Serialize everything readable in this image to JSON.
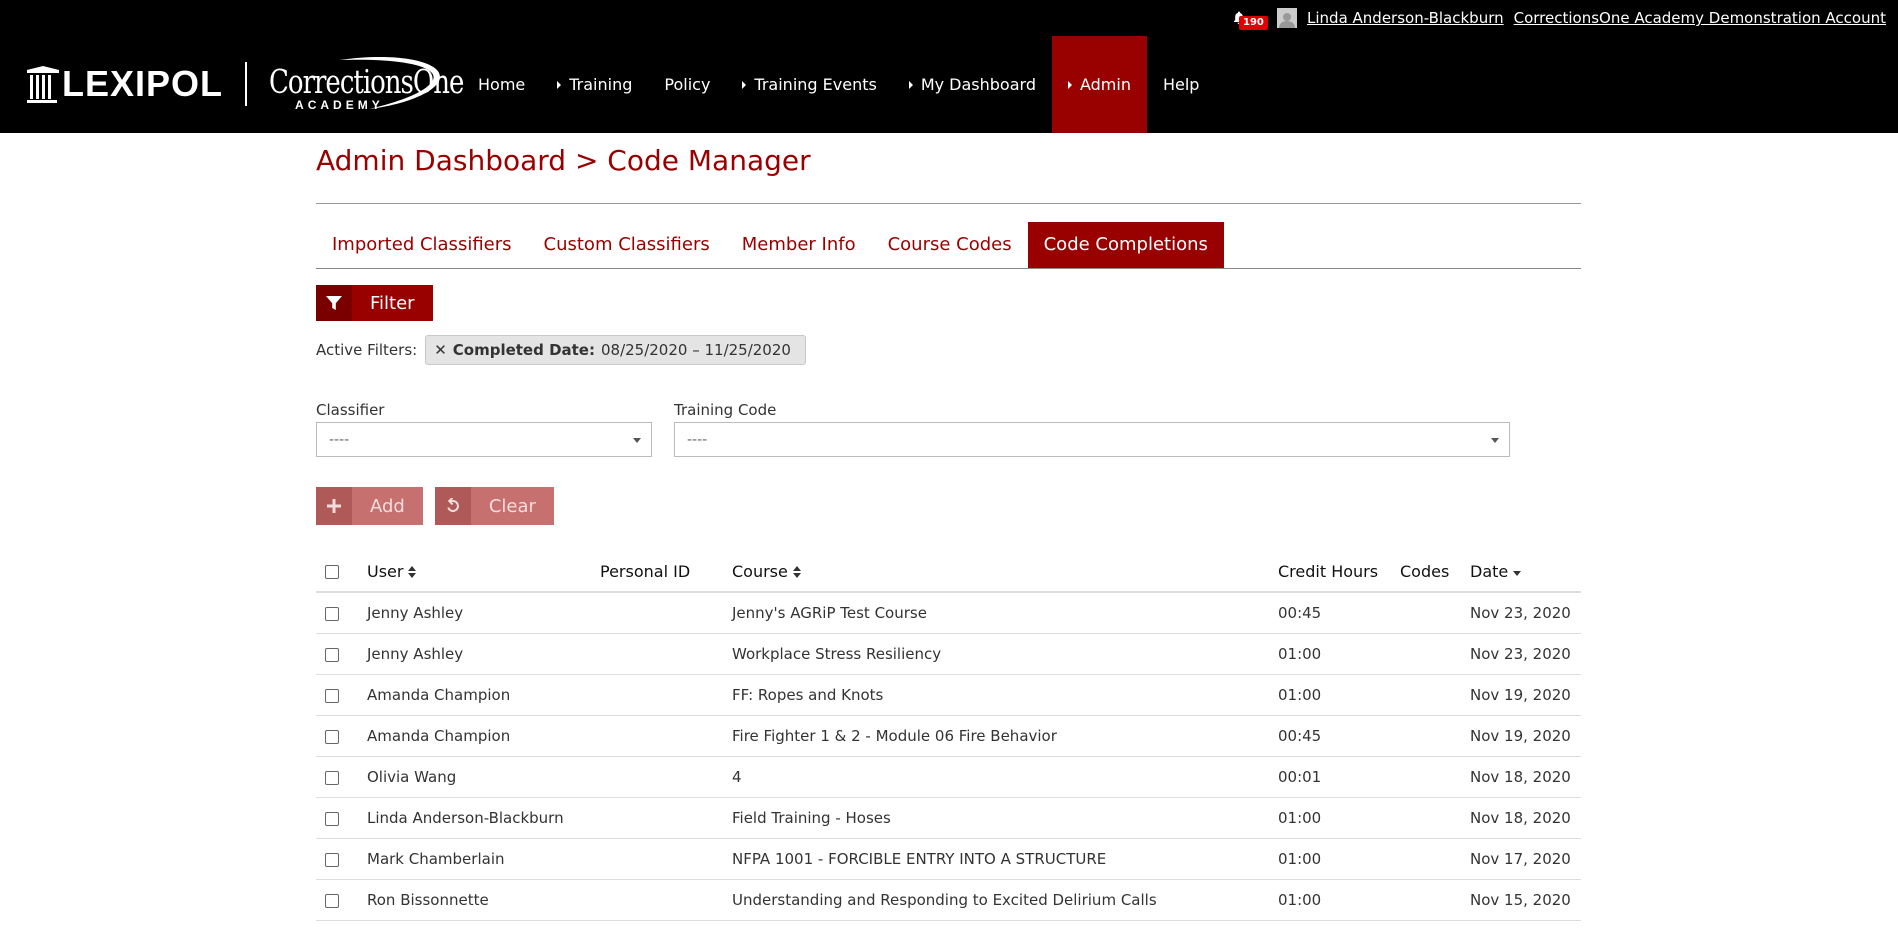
{
  "topbar": {
    "notification_count": "190",
    "user_name": "Linda Anderson-Blackburn",
    "account_name": "CorrectionsOne Academy Demonstration Account"
  },
  "brand": {
    "lexipol": "LEXIPOL",
    "academy_name": "CorrectionsOne",
    "academy_sub": "ACADEMY"
  },
  "nav": {
    "items": [
      {
        "label": "Home"
      },
      {
        "label": "Training"
      },
      {
        "label": "Policy"
      },
      {
        "label": "Training Events"
      },
      {
        "label": "My Dashboard"
      },
      {
        "label": "Admin"
      },
      {
        "label": "Help"
      }
    ]
  },
  "page": {
    "title": "Admin Dashboard > Code Manager"
  },
  "tabs": [
    {
      "label": "Imported Classifiers"
    },
    {
      "label": "Custom Classifiers"
    },
    {
      "label": "Member Info"
    },
    {
      "label": "Course Codes"
    },
    {
      "label": "Code Completions"
    }
  ],
  "filter": {
    "button_label": "Filter",
    "active_label": "Active Filters:",
    "chip_key": "Completed Date:",
    "chip_value": "08/25/2020 – 11/25/2020"
  },
  "selects": {
    "classifier_label": "Classifier",
    "classifier_value": "----",
    "training_code_label": "Training Code",
    "training_code_value": "----"
  },
  "actions": {
    "add_label": "Add",
    "clear_label": "Clear"
  },
  "table": {
    "headers": {
      "user": "User",
      "personal_id": "Personal ID",
      "course": "Course",
      "credit_hours": "Credit Hours",
      "codes": "Codes",
      "date": "Date"
    },
    "rows": [
      {
        "user": "Jenny Ashley",
        "personal_id": "",
        "course": "Jenny's AGRiP Test Course",
        "credit_hours": "00:45",
        "codes": "",
        "date": "Nov 23, 2020"
      },
      {
        "user": "Jenny Ashley",
        "personal_id": "",
        "course": "Workplace Stress Resiliency",
        "credit_hours": "01:00",
        "codes": "",
        "date": "Nov 23, 2020"
      },
      {
        "user": "Amanda Champion",
        "personal_id": "",
        "course": "FF: Ropes and Knots",
        "credit_hours": "01:00",
        "codes": "",
        "date": "Nov 19, 2020"
      },
      {
        "user": "Amanda Champion",
        "personal_id": "",
        "course": "Fire Fighter 1 & 2 - Module 06 Fire Behavior",
        "credit_hours": "00:45",
        "codes": "",
        "date": "Nov 19, 2020"
      },
      {
        "user": "Olivia Wang",
        "personal_id": "",
        "course": "4",
        "credit_hours": "00:01",
        "codes": "",
        "date": "Nov 18, 2020"
      },
      {
        "user": "Linda Anderson-Blackburn",
        "personal_id": "",
        "course": "Field Training - Hoses",
        "credit_hours": "01:00",
        "codes": "",
        "date": "Nov 18, 2020"
      },
      {
        "user": "Mark Chamberlain",
        "personal_id": "",
        "course": "NFPA 1001 - FORCIBLE ENTRY INTO A STRUCTURE",
        "credit_hours": "01:00",
        "codes": "",
        "date": "Nov 17, 2020"
      },
      {
        "user": "Ron Bissonnette",
        "personal_id": "",
        "course": "Understanding and Responding to Excited Delirium Calls",
        "credit_hours": "01:00",
        "codes": "",
        "date": "Nov 15, 2020"
      }
    ]
  },
  "colors": {
    "brand_red": "#990000",
    "nav_bg": "#000000",
    "badge_red": "#e00000",
    "disabled_button": "#c67070"
  }
}
